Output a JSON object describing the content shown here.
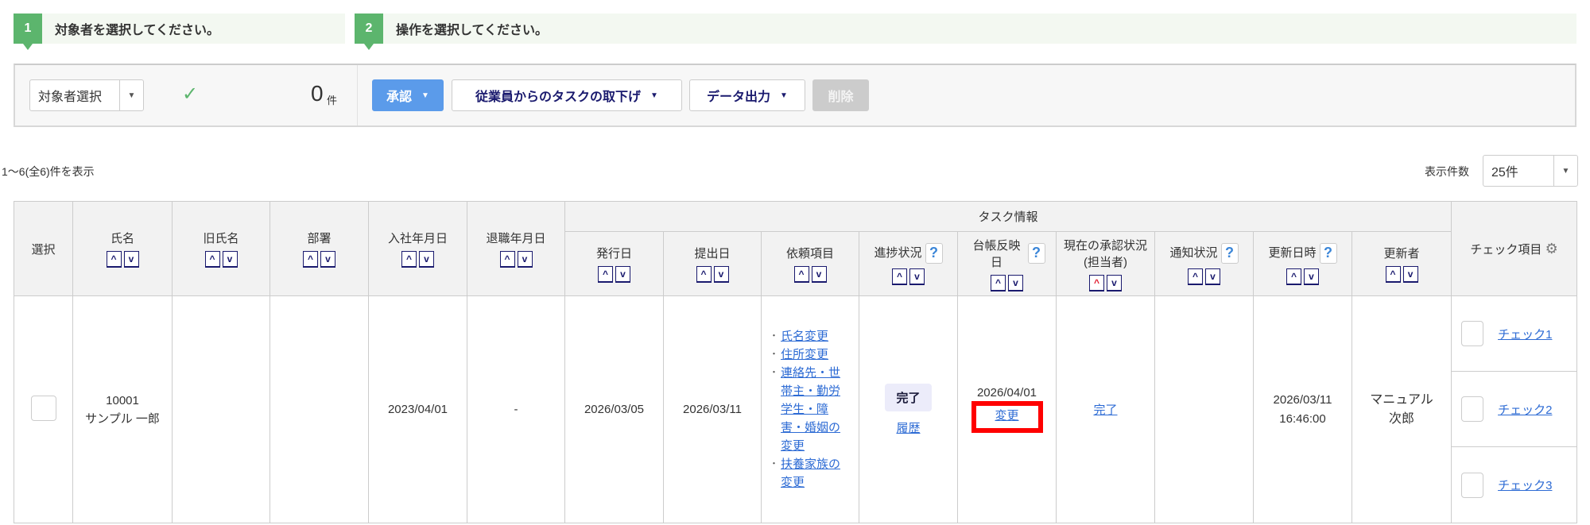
{
  "steps": [
    {
      "num": "1",
      "text": "対象者を選択してください。"
    },
    {
      "num": "2",
      "text": "操作を選択してください。"
    }
  ],
  "toolbar": {
    "target_select": "対象者選択",
    "count": "0",
    "count_unit": "件",
    "approve": "承認",
    "withdraw": "従業員からのタスクの取下げ",
    "export": "データ出力",
    "delete": "削除"
  },
  "summary": "1～6(全6)件を表示",
  "page_size": {
    "label": "表示件数",
    "value": "25件"
  },
  "table": {
    "group_header": "タスク情報",
    "headers": {
      "select": "選択",
      "name": "氏名",
      "old_name": "旧氏名",
      "dept": "部署",
      "hire": "入社年月日",
      "retire": "退職年月日",
      "issue": "発行日",
      "submit": "提出日",
      "request": "依頼項目",
      "progress": "進捗状況",
      "ledger": "台帳反映日",
      "approval": "現在の承認状況 (担当者)",
      "notice": "通知状況",
      "updated": "更新日時",
      "updater": "更新者",
      "check": "チェック項目"
    },
    "row": {
      "emp_no": "10001",
      "name": "サンプル 一郎",
      "old_name": "",
      "dept": "",
      "hire": "2023/04/01",
      "retire": "-",
      "issue": "2026/03/05",
      "submit": "2026/03/11",
      "requests": [
        "氏名変更",
        "住所変更",
        "連絡先・世帯主・勤労学生・障害・婚姻の変更",
        "扶養家族の変更"
      ],
      "progress": "完了",
      "history": "履歴",
      "ledger_date": "2026/04/01",
      "ledger_change": "変更",
      "approval": "完了",
      "notice": "",
      "updated_date": "2026/03/11",
      "updated_time": "16:46:00",
      "updater": "マニュアル 次郎",
      "checks": [
        "チェック1",
        "チェック2",
        "チェック3"
      ]
    }
  },
  "colors": {
    "green": "#5cb56d",
    "blue": "#5b9bea",
    "navy": "#1a1a6e",
    "highlight": "#ff0000"
  }
}
